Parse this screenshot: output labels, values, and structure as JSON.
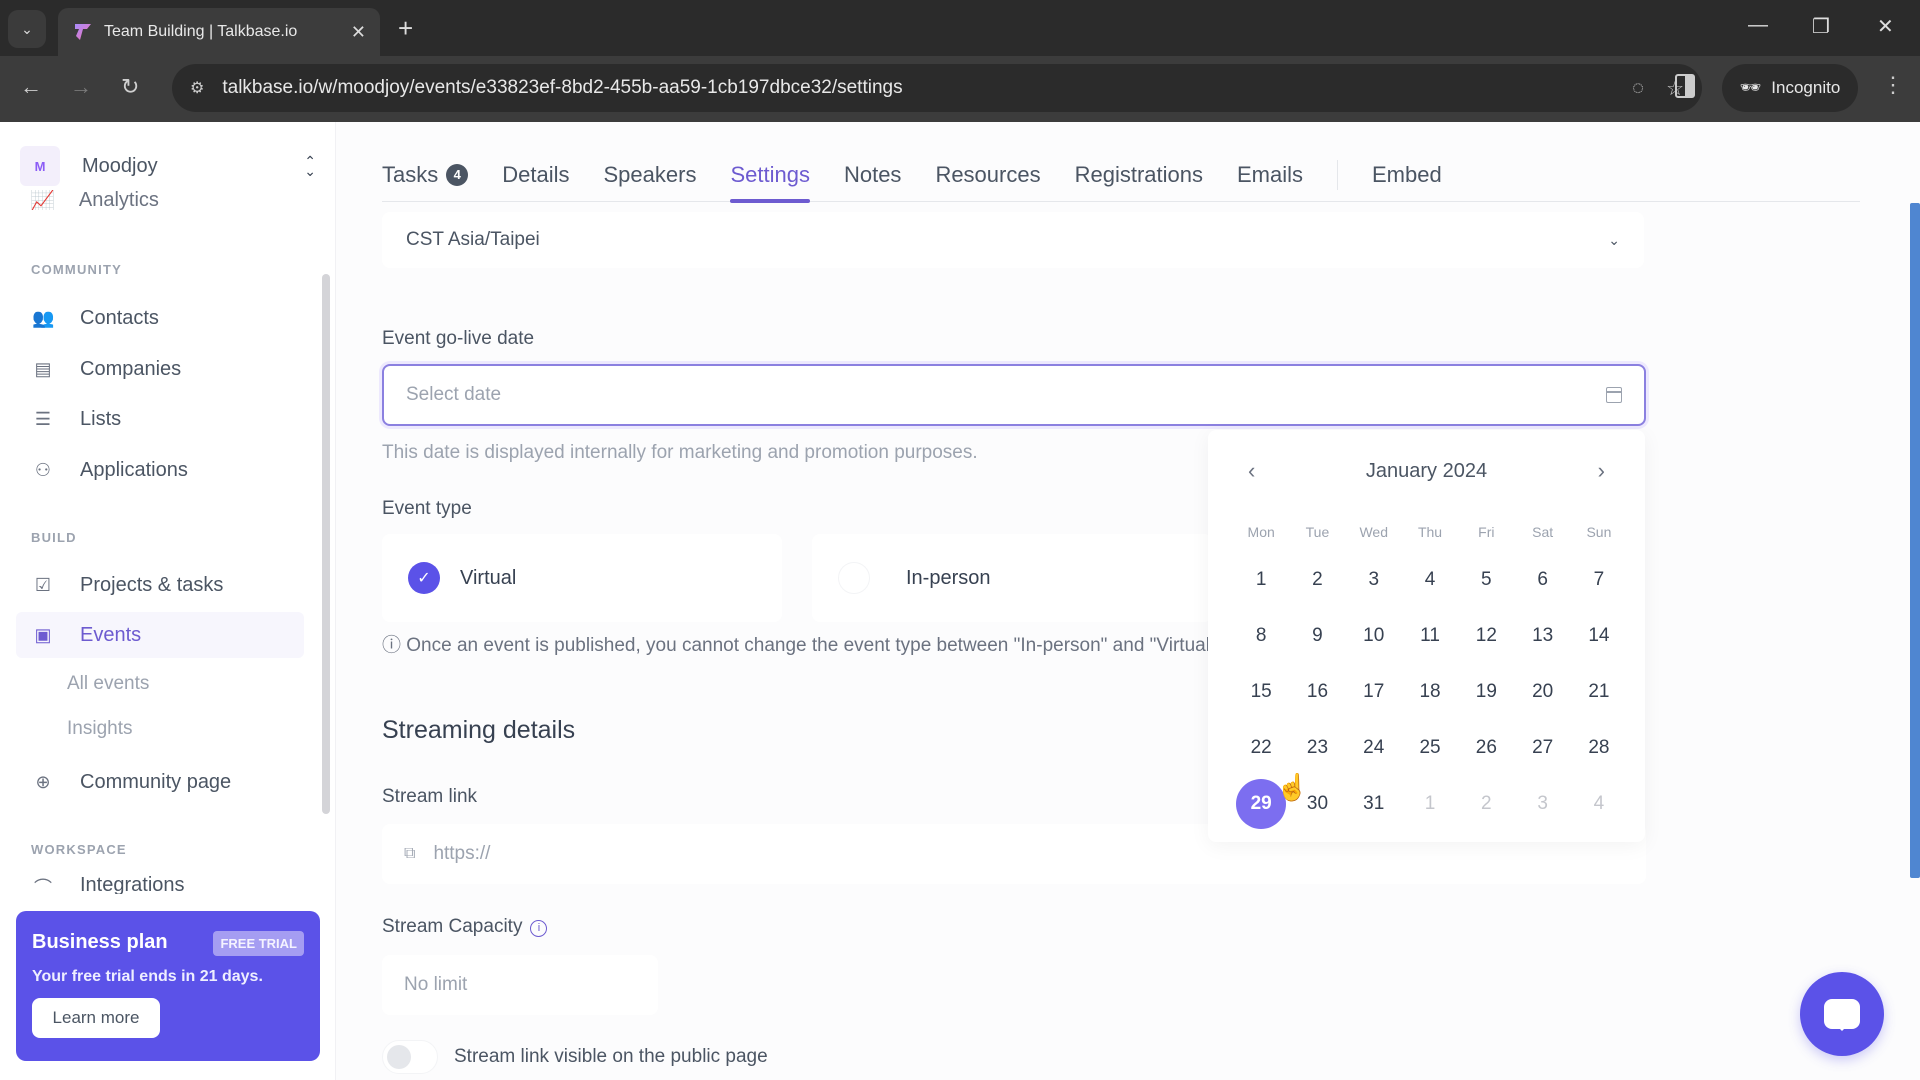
{
  "browser": {
    "tab_title": "Team Building | Talkbase.io",
    "url": "talkbase.io/w/moodjoy/events/e33823ef-8bd2-455b-aa59-1cb197dbce32/settings",
    "incognito_label": "Incognito"
  },
  "sidebar": {
    "workspace_initial": "M",
    "workspace_name": "Moodjoy",
    "partial_item": "Analytics",
    "sections": {
      "community": "COMMUNITY",
      "build": "BUILD",
      "workspace": "WORKSPACE"
    },
    "community_items": [
      {
        "label": "Contacts",
        "icon": "contacts-icon"
      },
      {
        "label": "Companies",
        "icon": "companies-icon"
      },
      {
        "label": "Lists",
        "icon": "list-icon"
      },
      {
        "label": "Applications",
        "icon": "add-user-icon"
      }
    ],
    "build_items": [
      {
        "label": "Projects & tasks",
        "icon": "task-icon"
      },
      {
        "label": "Events",
        "icon": "calendar-icon",
        "active": true
      }
    ],
    "events_sub": [
      "All events",
      "Insights"
    ],
    "community_page": "Community page",
    "workspace_partial": "Integrations",
    "plan": {
      "title": "Business plan",
      "badge": "FREE TRIAL",
      "text": "Your free trial ends in 21 days.",
      "button": "Learn more"
    }
  },
  "main": {
    "tabs": [
      {
        "label": "Tasks",
        "badge": "4"
      },
      {
        "label": "Details"
      },
      {
        "label": "Speakers"
      },
      {
        "label": "Settings",
        "active": true
      },
      {
        "label": "Notes"
      },
      {
        "label": "Resources"
      },
      {
        "label": "Registrations"
      },
      {
        "label": "Emails"
      },
      {
        "label": "Embed"
      }
    ],
    "timezone_value": "CST Asia/Taipei",
    "go_live": {
      "label": "Event go-live date",
      "placeholder": "Select date",
      "hint": "This date is displayed internally for marketing and promotion purposes."
    },
    "event_type": {
      "label": "Event type",
      "options": [
        {
          "label": "Virtual",
          "selected": true
        },
        {
          "label": "In-person",
          "selected": false
        }
      ],
      "info": "Once an event is published, you cannot change the event type between \"In-person\" and \"Virtual\"."
    },
    "streaming": {
      "title": "Streaming details",
      "link_label": "Stream link",
      "link_placeholder": "https://",
      "capacity_label": "Stream Capacity",
      "capacity_placeholder": "No limit",
      "visible_toggle_label": "Stream link visible on the public page",
      "visible_toggle_on": false
    }
  },
  "calendar": {
    "month_label": "January 2024",
    "weekdays": [
      "Mon",
      "Tue",
      "Wed",
      "Thu",
      "Fri",
      "Sat",
      "Sun"
    ],
    "days": [
      {
        "d": "1"
      },
      {
        "d": "2"
      },
      {
        "d": "3"
      },
      {
        "d": "4"
      },
      {
        "d": "5"
      },
      {
        "d": "6"
      },
      {
        "d": "7"
      },
      {
        "d": "8"
      },
      {
        "d": "9"
      },
      {
        "d": "10"
      },
      {
        "d": "11"
      },
      {
        "d": "12"
      },
      {
        "d": "13"
      },
      {
        "d": "14"
      },
      {
        "d": "15"
      },
      {
        "d": "16"
      },
      {
        "d": "17"
      },
      {
        "d": "18"
      },
      {
        "d": "19"
      },
      {
        "d": "20"
      },
      {
        "d": "21"
      },
      {
        "d": "22"
      },
      {
        "d": "23"
      },
      {
        "d": "24"
      },
      {
        "d": "25"
      },
      {
        "d": "26"
      },
      {
        "d": "27"
      },
      {
        "d": "28"
      },
      {
        "d": "29",
        "selected": true
      },
      {
        "d": "30"
      },
      {
        "d": "31"
      },
      {
        "d": "1",
        "outside": true
      },
      {
        "d": "2",
        "outside": true
      },
      {
        "d": "3",
        "outside": true
      },
      {
        "d": "4",
        "outside": true
      }
    ]
  },
  "colors": {
    "accent": "#5b52e8",
    "active_tab": "#6d5bd0",
    "selected_day": "#7c6ef0"
  }
}
